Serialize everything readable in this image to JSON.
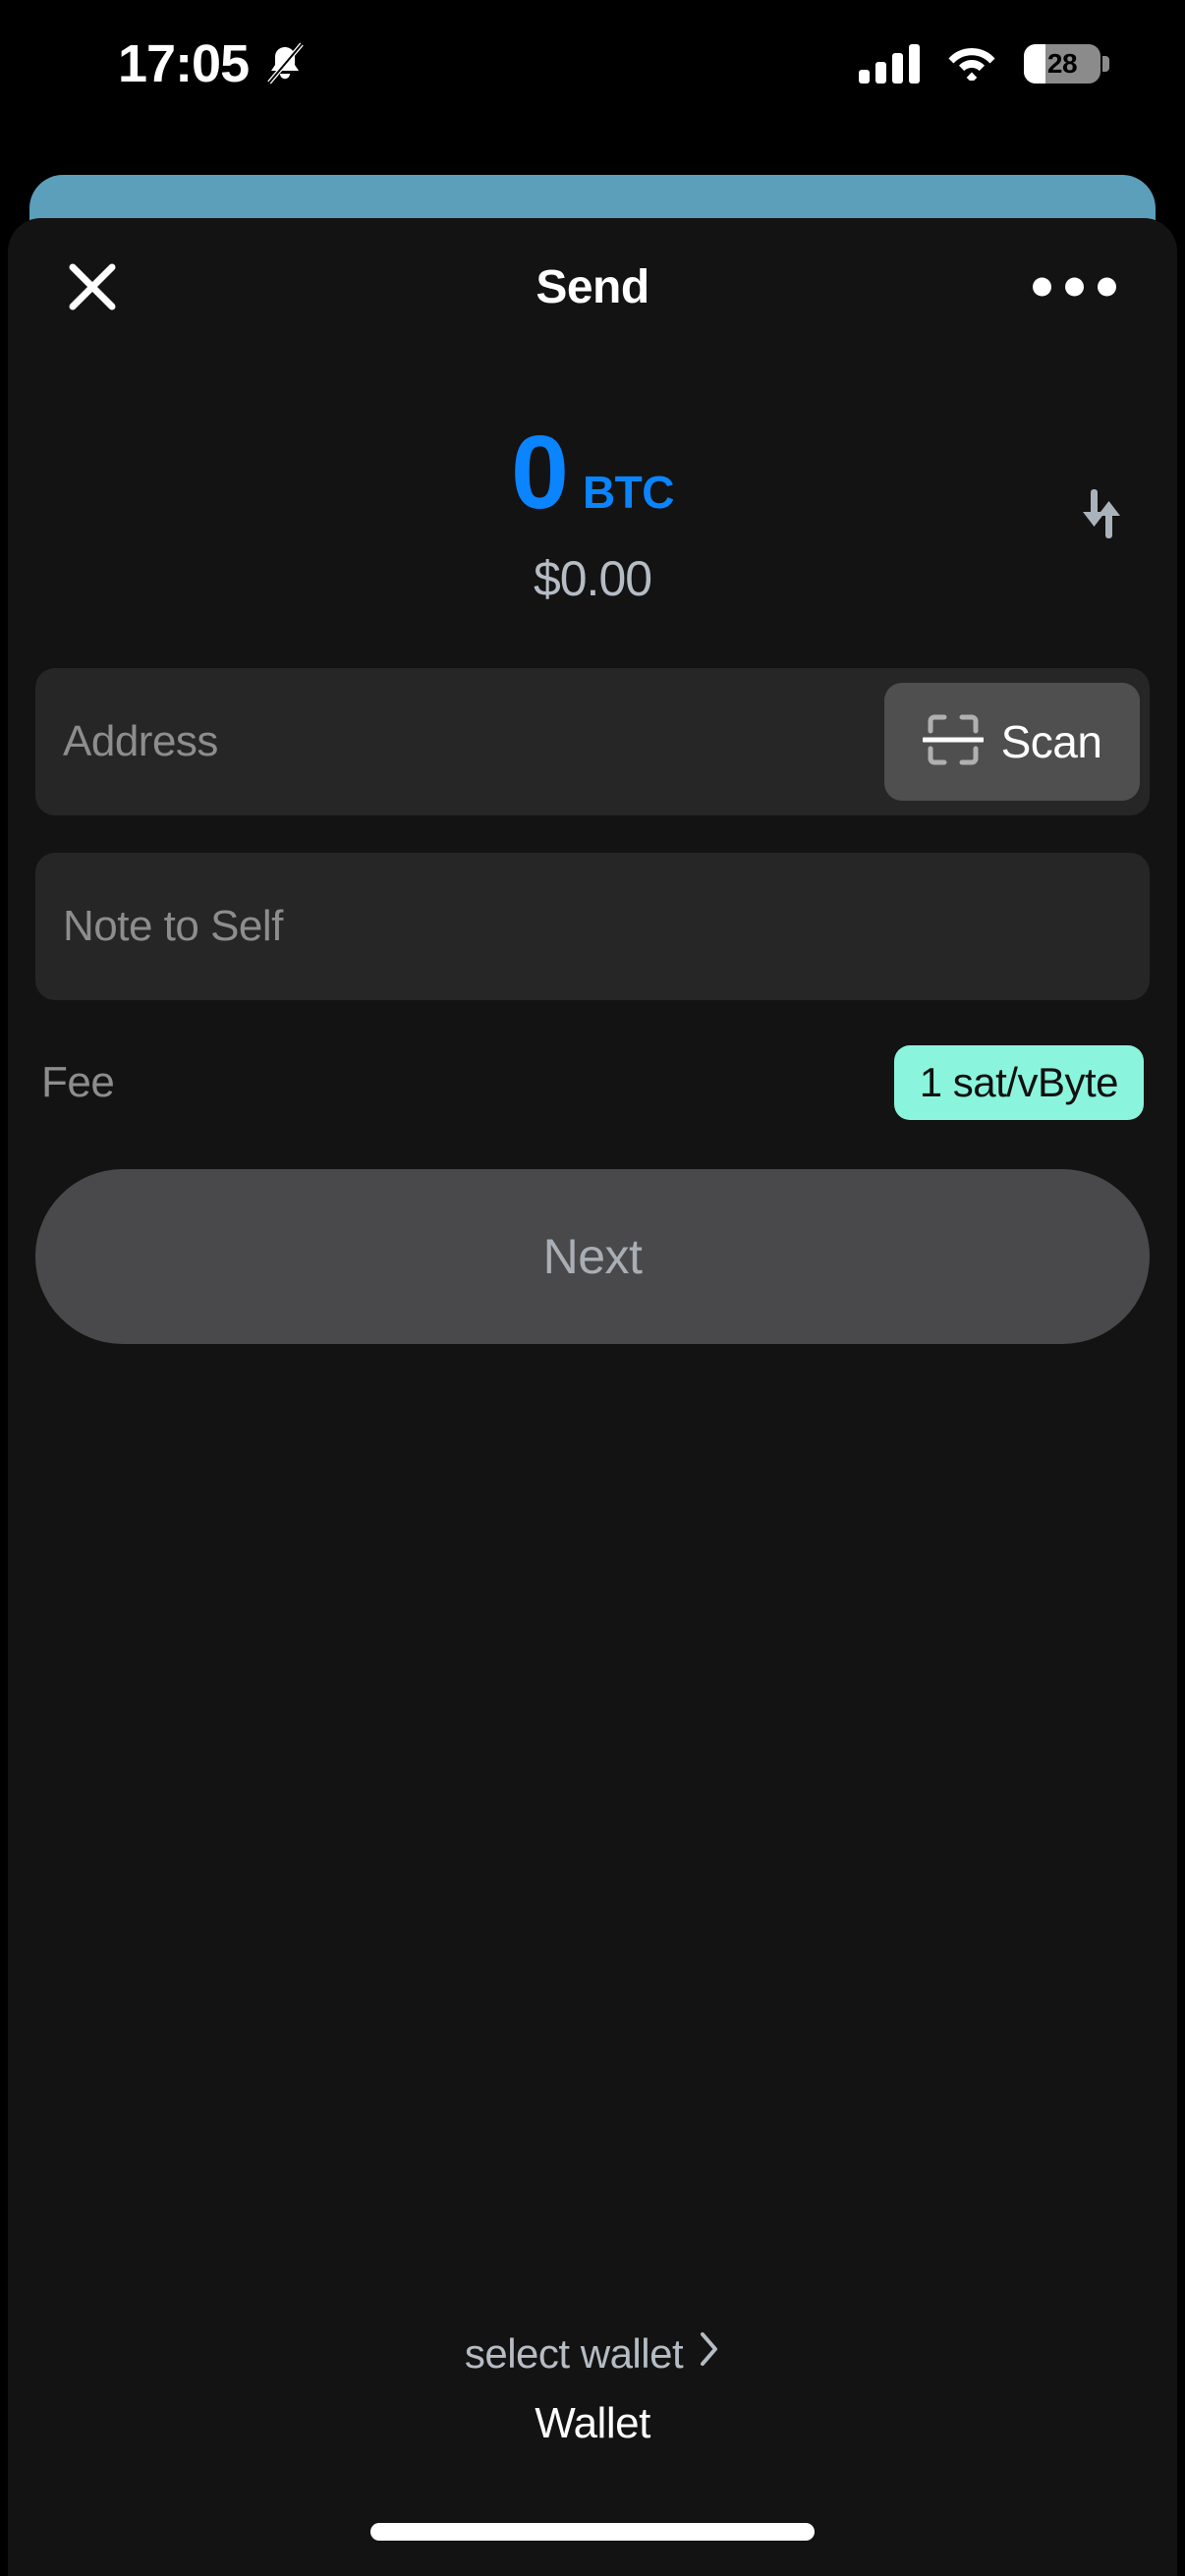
{
  "status_bar": {
    "time": "17:05",
    "silent_icon": "bell-slash-icon",
    "signal_icon": "cellular-signal-icon",
    "wifi_icon": "wifi-icon",
    "battery_percent": "28",
    "battery_level": 28
  },
  "behind_card": {
    "color": "#5b9fba"
  },
  "header": {
    "close_icon": "close-icon",
    "title": "Send",
    "more_icon": "more-options-icon"
  },
  "amount": {
    "value": "0",
    "unit": "BTC",
    "fiat": "$0.00",
    "swap_icon": "swap-currency-icon",
    "accent_color": "#0a84ff"
  },
  "address_field": {
    "placeholder": "Address",
    "value": "",
    "scan_label": "Scan",
    "scan_icon": "qr-scan-icon"
  },
  "note_field": {
    "placeholder": "Note to Self",
    "value": ""
  },
  "fee": {
    "label": "Fee",
    "badge": "1 sat/vByte",
    "badge_color": "#8af5dc"
  },
  "next_button": {
    "label": "Next",
    "enabled": false
  },
  "wallet_selector": {
    "select_label": "select wallet",
    "chevron_icon": "chevron-right-icon",
    "wallet_name": "Wallet"
  },
  "home_indicator": {
    "name": "home-indicator"
  }
}
